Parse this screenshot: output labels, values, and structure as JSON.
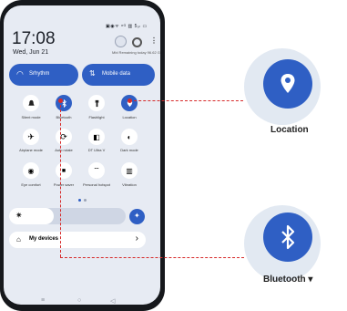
{
  "status_bar": {
    "icons_text": "▣◉ᯤ ⁸ᴳ ▥ 5ₒₗ ▭"
  },
  "header": {
    "time": "17:08",
    "date": "Wed, Jun 21",
    "data_remaining": "Mbl Remaining today 96.62 G"
  },
  "wide_tiles": [
    {
      "label": "Srhythm",
      "icon": "wifi-icon"
    },
    {
      "label": "Mobile data",
      "icon": "mobile-data-icon"
    }
  ],
  "tiles": [
    {
      "label": "Silent mode",
      "icon": "bell-icon",
      "active": false
    },
    {
      "label": "Bluetooth",
      "icon": "bluetooth-icon",
      "active": true
    },
    {
      "label": "Flashlight",
      "icon": "flashlight-icon",
      "active": false
    },
    {
      "label": "Location",
      "icon": "location-icon",
      "active": true
    },
    {
      "label": "Airplane mode",
      "icon": "airplane-icon",
      "active": false
    },
    {
      "label": "Auto rotate",
      "icon": "rotate-icon",
      "active": false
    },
    {
      "label": "DT Ultra V",
      "icon": "battery-saver-icon",
      "active": false
    },
    {
      "label": "Dark mode",
      "icon": "dark-mode-icon",
      "active": false
    },
    {
      "label": "Eye comfort",
      "icon": "eye-icon",
      "active": false
    },
    {
      "label": "Power saver",
      "icon": "video-icon",
      "active": false
    },
    {
      "label": "Personal hotspot",
      "icon": "hotspot-icon",
      "active": false
    },
    {
      "label": "Vibration",
      "icon": "vibration-icon",
      "active": false
    }
  ],
  "brightness": {
    "level": 0.38
  },
  "devices": {
    "label": "My devices",
    "chevron": "›"
  },
  "navbar": {
    "menu": "≡",
    "home": "○",
    "back": "◁"
  },
  "callouts": [
    {
      "label": "Location",
      "icon": "location-icon"
    },
    {
      "label": "Bluetooth ▾",
      "icon": "bluetooth-icon"
    }
  ],
  "colors": {
    "accent": "#2f5fc4",
    "panel": "#e7ebf3",
    "callout_bg": "#e2e9f2",
    "leader": "#d62a2a"
  }
}
